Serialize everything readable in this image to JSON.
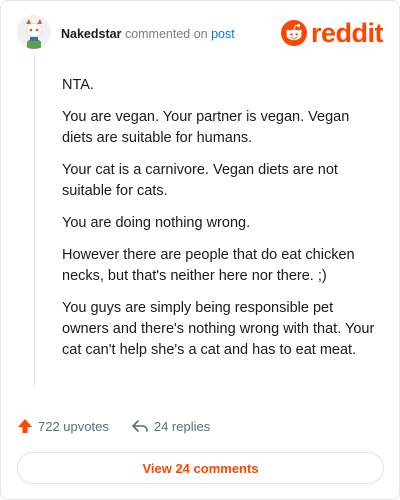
{
  "header": {
    "username": "Nakedstar",
    "commented_text": "commented on",
    "post_link": "post",
    "logo_text": "reddit"
  },
  "comment": {
    "paragraphs": [
      "NTA.",
      "You are vegan. Your partner is vegan. Vegan diets are suitable for humans.",
      "Your cat is a carnivore. Vegan diets are not suitable for cats.",
      "You are doing nothing wrong.",
      "However there are people that do eat chicken necks, but that's neither here nor there. ;)",
      "You guys are simply being responsible pet owners and there's nothing wrong with that. Your cat can't help she's a cat and has to eat meat."
    ]
  },
  "actions": {
    "upvotes": "722 upvotes",
    "replies": "24 replies"
  },
  "footer": {
    "view_comments": "View 24 comments"
  },
  "colors": {
    "brand": "#ff4500",
    "link": "#0079d3",
    "muted": "#576f76"
  },
  "icons": {
    "upvote": "upvote-arrow-icon",
    "reply": "reply-arrow-icon",
    "logo": "reddit-snoo-icon",
    "avatar": "snoo-avatar-icon"
  }
}
